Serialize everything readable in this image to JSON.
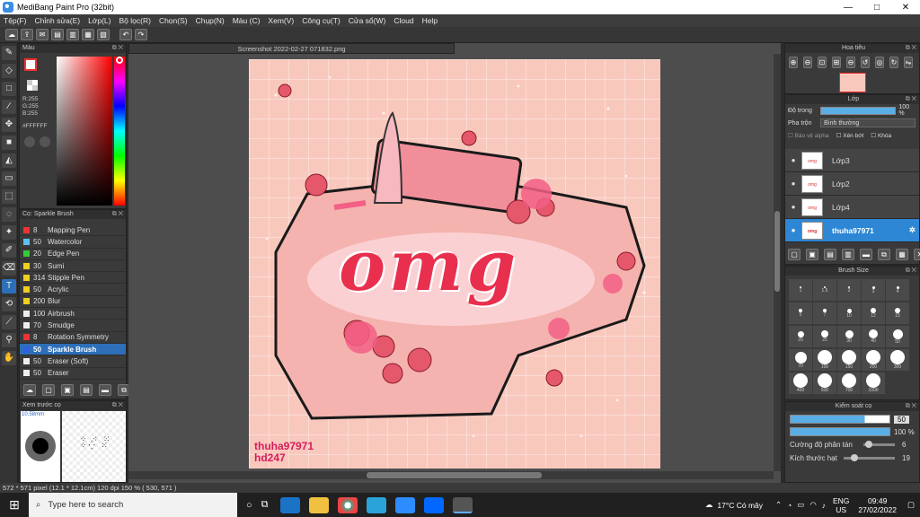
{
  "window": {
    "title": "MediBang Paint Pro (32bit)",
    "min": "—",
    "max": "□",
    "close": "✕"
  },
  "menu": [
    "Tệp(F)",
    "Chỉnh sửa(E)",
    "Lớp(L)",
    "Bộ lọc(R)",
    "Chọn(S)",
    "Chụp(N)",
    "Màu (C)",
    "Xem(V)",
    "Công cụ(T)",
    "Cửa sổ(W)",
    "Cloud",
    "Help"
  ],
  "color_panel": {
    "title": "Màu",
    "r": "R:255",
    "g": "G:255",
    "b": "B:255",
    "hex": "#FFFFFF"
  },
  "brush_panel": {
    "title": "Cọ: Sparkle Brush",
    "items": [
      {
        "size": "8",
        "name": "Mapping Pen",
        "color": "#e33"
      },
      {
        "size": "50",
        "name": "Watercolor",
        "color": "#5bc0f0"
      },
      {
        "size": "20",
        "name": "Edge Pen",
        "color": "#3c3"
      },
      {
        "size": "30",
        "name": "Sumi",
        "color": "#f0d020"
      },
      {
        "size": "314",
        "name": "Stipple Pen",
        "color": "#f0d020"
      },
      {
        "size": "50",
        "name": "Acrylic",
        "color": "#f0d020"
      },
      {
        "size": "200",
        "name": "Blur",
        "color": "#f0d020"
      },
      {
        "size": "100",
        "name": "Airbrush",
        "color": "#eee"
      },
      {
        "size": "70",
        "name": "Smudge",
        "color": "#eee"
      },
      {
        "size": "8",
        "name": "Rotation Symmetry",
        "color": "#e33"
      },
      {
        "size": "50",
        "name": "Sparkle Brush",
        "color": "#3060e0"
      },
      {
        "size": "50",
        "name": "Eraser (Soft)",
        "color": "#eee"
      },
      {
        "size": "50",
        "name": "Eraser",
        "color": "#eee"
      }
    ]
  },
  "preview_panel": {
    "title": "Xem trước cọ",
    "size": "10.58mm"
  },
  "document": {
    "tab": "Screenshot 2022-02-27 071832.png",
    "art_text": "omg",
    "sig1": "thuha97971",
    "sig2": "hd247"
  },
  "navigator": {
    "title": "Hoa tiêu"
  },
  "layers": {
    "title": "Lớp",
    "opacity_label": "Độ trong",
    "opacity_value": "100 %",
    "blend_label": "Pha trộn",
    "blend_value": "Bình thường",
    "protect_alpha": "Bảo vệ alpha",
    "clip": "Xén bớt",
    "lock": "Khóa",
    "rows": [
      {
        "name": "Lớp3",
        "selected": false
      },
      {
        "name": "Lớp2",
        "selected": false
      },
      {
        "name": "Lớp4",
        "selected": false
      },
      {
        "name": "thuha97971",
        "selected": true
      }
    ]
  },
  "brush_size": {
    "title": "Brush Size",
    "sizes": [
      "1",
      "1.5",
      "2",
      "3",
      "4",
      "5",
      "7",
      "10",
      "12",
      "15",
      "20",
      "25",
      "30",
      "40",
      "50",
      "70",
      "100",
      "150",
      "200",
      "300",
      "400",
      "500",
      "700",
      "1000"
    ]
  },
  "control": {
    "title": "Kiểm soát cọ",
    "size_val": "50",
    "opacity_val": "100 %",
    "scatter_label": "Cường độ phân tán",
    "scatter_val": "6",
    "dot_label": "Kích thước hạt",
    "dot_val": "19"
  },
  "status": {
    "text": "572 * 571 pixel   (12.1 * 12.1cm)   120 dpi   150 %   ( 530, 571 )"
  },
  "taskbar": {
    "search": "Type here to search",
    "weather": "17°C  Có mây",
    "lang1": "ENG",
    "lang2": "US",
    "time": "09:49",
    "date": "27/02/2022"
  }
}
